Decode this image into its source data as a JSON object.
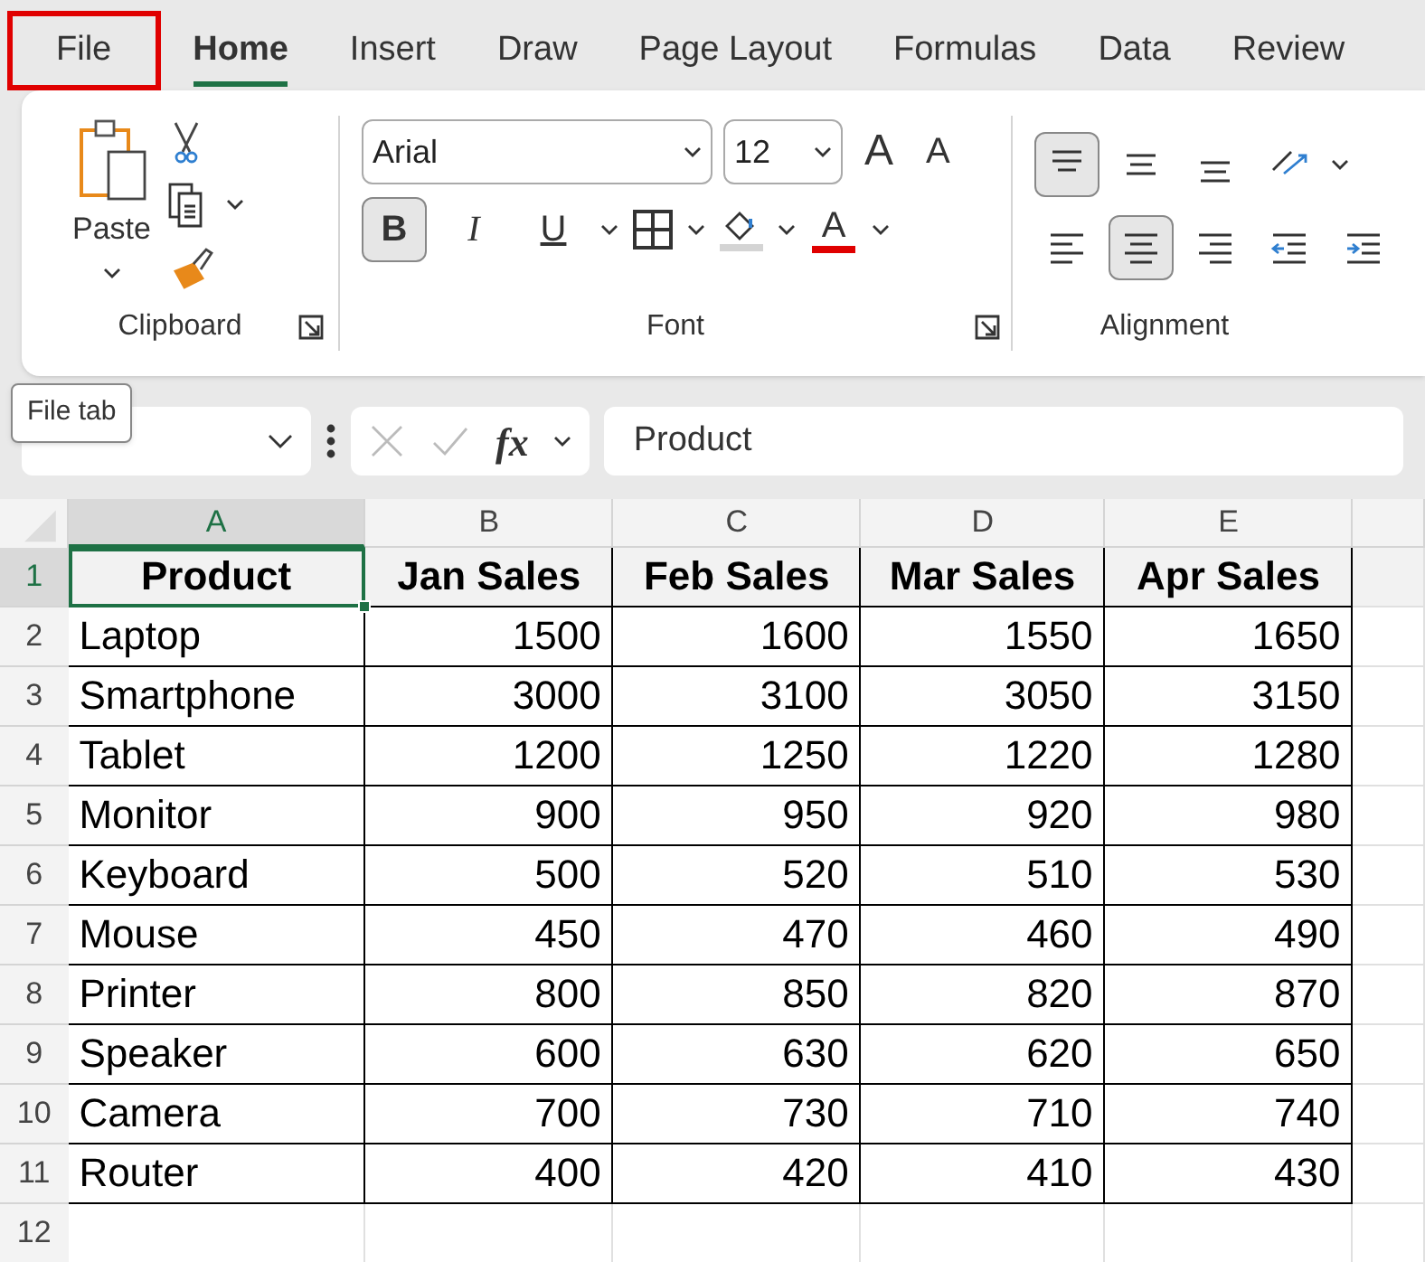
{
  "tabs": [
    {
      "label": "File",
      "selected": false,
      "outlined": true
    },
    {
      "label": "Home",
      "selected": true,
      "outlined": false
    },
    {
      "label": "Insert",
      "selected": false,
      "outlined": false
    },
    {
      "label": "Draw",
      "selected": false,
      "outlined": false
    },
    {
      "label": "Page Layout",
      "selected": false,
      "outlined": false
    },
    {
      "label": "Formulas",
      "selected": false,
      "outlined": false
    },
    {
      "label": "Data",
      "selected": false,
      "outlined": false
    },
    {
      "label": "Review",
      "selected": false,
      "outlined": false
    }
  ],
  "clipboard": {
    "paste_label": "Paste",
    "group_label": "Clipboard"
  },
  "font": {
    "font_name": "Arial",
    "font_size": "12",
    "group_label": "Font",
    "buttons": [
      {
        "kind": "bold",
        "label": "B",
        "selected": true
      },
      {
        "kind": "italic",
        "label": "I",
        "selected": false
      },
      {
        "kind": "underline",
        "label": "U",
        "selected": false
      },
      {
        "kind": "borders",
        "selected": false
      },
      {
        "kind": "fill",
        "selected": false
      },
      {
        "kind": "fontcolor",
        "label": "A",
        "selected": false
      }
    ],
    "grow_label": "A",
    "shrink_label": "A"
  },
  "alignment": {
    "group_label": "Alignment",
    "row_1": [
      {
        "kind": "top",
        "selected": true
      },
      {
        "kind": "middle",
        "selected": false
      },
      {
        "kind": "bottom",
        "selected": false
      },
      {
        "kind": "orientation",
        "selected": false
      }
    ],
    "row_2": [
      {
        "kind": "left",
        "selected": false
      },
      {
        "kind": "center",
        "selected": true
      },
      {
        "kind": "right",
        "selected": false
      },
      {
        "kind": "outdent",
        "selected": false
      },
      {
        "kind": "indent",
        "selected": false
      }
    ]
  },
  "tooltip": "File tab",
  "formula_bar": {
    "fx": "fx",
    "value": "Product"
  },
  "sheet": {
    "columns": [
      {
        "label": "A",
        "selected": true
      },
      {
        "label": "B",
        "selected": false
      },
      {
        "label": "C",
        "selected": false
      },
      {
        "label": "D",
        "selected": false
      },
      {
        "label": "E",
        "selected": false
      }
    ],
    "rows": [
      {
        "number": "1",
        "cells": [
          "Product",
          "Jan Sales",
          "Feb Sales",
          "Mar Sales",
          "Apr Sales"
        ],
        "header": true
      },
      {
        "number": "2",
        "cells": [
          "Laptop",
          "1500",
          "1600",
          "1550",
          "1650"
        ],
        "header": false
      },
      {
        "number": "3",
        "cells": [
          "Smartphone",
          "3000",
          "3100",
          "3050",
          "3150"
        ],
        "header": false
      },
      {
        "number": "4",
        "cells": [
          "Tablet",
          "1200",
          "1250",
          "1220",
          "1280"
        ],
        "header": false
      },
      {
        "number": "5",
        "cells": [
          "Monitor",
          "900",
          "950",
          "920",
          "980"
        ],
        "header": false
      },
      {
        "number": "6",
        "cells": [
          "Keyboard",
          "500",
          "520",
          "510",
          "530"
        ],
        "header": false
      },
      {
        "number": "7",
        "cells": [
          "Mouse",
          "450",
          "470",
          "460",
          "490"
        ],
        "header": false
      },
      {
        "number": "8",
        "cells": [
          "Printer",
          "800",
          "850",
          "820",
          "870"
        ],
        "header": false
      },
      {
        "number": "9",
        "cells": [
          "Speaker",
          "600",
          "630",
          "620",
          "650"
        ],
        "header": false
      },
      {
        "number": "10",
        "cells": [
          "Camera",
          "700",
          "730",
          "710",
          "740"
        ],
        "header": false
      },
      {
        "number": "11",
        "cells": [
          "Router",
          "400",
          "420",
          "410",
          "430"
        ],
        "header": false
      },
      {
        "number": "12",
        "cells": [],
        "header": false
      }
    ]
  }
}
